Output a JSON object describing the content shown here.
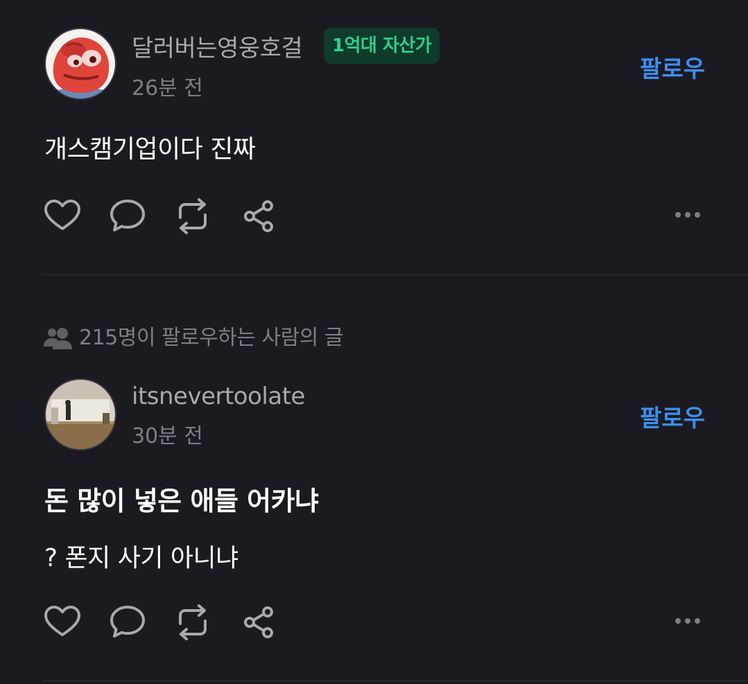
{
  "posts": [
    {
      "username": "달러버는영웅호걸",
      "badge": "1억대 자산가",
      "time": "26분 전",
      "follow_label": "팔로우",
      "text": "개스캠기업이다 진짜"
    },
    {
      "context": "215명이 팔로우하는 사람의 글",
      "username": "itsnevertoolate",
      "time": "30분 전",
      "follow_label": "팔로우",
      "headline": "돈 많이 넣은 애들 어카냐",
      "text": "? 폰지 사기 아니냐"
    }
  ],
  "icons": [
    "heart-icon",
    "comment-icon",
    "repost-icon",
    "share-icon",
    "more-icon",
    "people-icon"
  ],
  "colors": {
    "background": "#1b1a20",
    "follow": "#3d8ef0",
    "badge_text": "#2ecf8a",
    "badge_bg": "#0f3a2c",
    "muted": "#7f7e85"
  }
}
